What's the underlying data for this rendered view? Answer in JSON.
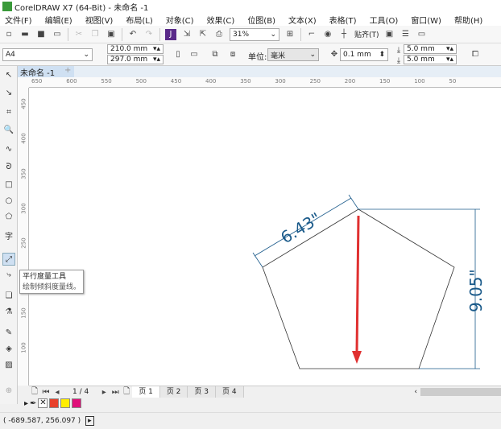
{
  "title": "CorelDRAW X7 (64-Bit) - 未命名 -1",
  "menu": [
    "文件(F)",
    "编辑(E)",
    "视图(V)",
    "布局(L)",
    "对象(C)",
    "效果(C)",
    "位图(B)",
    "文本(X)",
    "表格(T)",
    "工具(O)",
    "窗口(W)",
    "帮助(H)"
  ],
  "toolbar": {
    "zoom": "31%",
    "snap": "贴齐(T)"
  },
  "propbar": {
    "page_size": "A4",
    "width": "210.0 mm",
    "height": "297.0 mm",
    "unit_label": "单位:",
    "unit": "毫米",
    "nudge": "0.1 mm",
    "dup_x": "5.0 mm",
    "dup_y": "5.0 mm"
  },
  "doc_tab": "未命名 -1",
  "hruler": [
    "650",
    "600",
    "550",
    "500",
    "450",
    "400",
    "350",
    "300",
    "250",
    "200",
    "150",
    "100",
    "50"
  ],
  "vruler": [
    "450",
    "400",
    "350",
    "300",
    "250",
    "200",
    "150",
    "100"
  ],
  "tooltip": {
    "title": "平行度量工具",
    "desc": "绘制倾斜度量线。"
  },
  "drawing": {
    "dim_side": "6.43\"",
    "dim_height": "9.05\"",
    "dim_color": "#1a5a8a",
    "arrow_color": "#e03030"
  },
  "pages": {
    "counter": "1 / 4",
    "tabs": [
      "页 1",
      "页 2",
      "页 3",
      "页 4"
    ]
  },
  "palette": [
    "#e8402a",
    "#ffee00",
    "#e0107a"
  ],
  "status": {
    "coords": "( -689.587, 256.097 )"
  }
}
